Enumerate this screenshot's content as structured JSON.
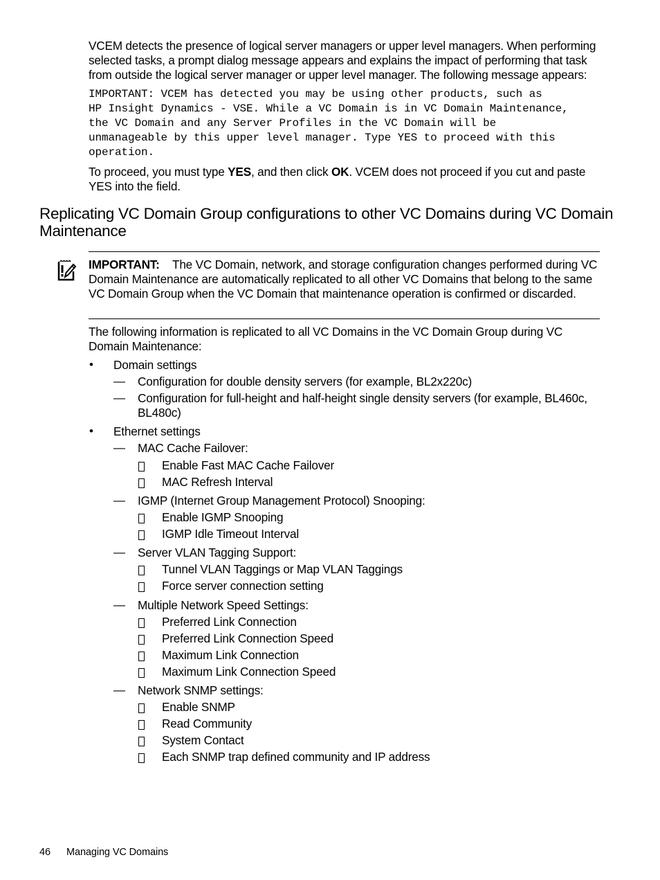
{
  "intro": {
    "para1": "VCEM detects the presence of logical server managers or upper level managers. When performing selected tasks, a prompt dialog message appears and explains the impact of performing that task from outside the logical server manager or upper level manager. The following message appears:",
    "message_lines": [
      "IMPORTANT: VCEM has detected you may be using other products, such as",
      "HP Insight Dynamics - VSE. While a VC Domain is in VC Domain Maintenance,",
      "the VC Domain and any Server Profiles in the VC Domain will be",
      "unmanageable by this upper level manager. Type YES to proceed with this",
      "operation."
    ],
    "para2_a": "To proceed, you must type ",
    "para2_yes": "YES",
    "para2_b": ", and then click ",
    "para2_ok": "OK",
    "para2_c": ". VCEM does not proceed if you cut and paste YES into the field."
  },
  "section": {
    "heading": "Replicating VC Domain Group configurations to other VC Domains during VC Domain Maintenance",
    "important_label": "IMPORTANT:",
    "important_text": "The VC Domain, network, and storage configuration changes performed during VC Domain Maintenance are automatically replicated to all other VC Domains that belong to the same VC Domain Group when the VC Domain that maintenance operation is confirmed or discarded.",
    "lead": "The following information is replicated to all VC Domains in the VC Domain Group during VC Domain Maintenance:",
    "bullet_glyph": "•",
    "dash_glyph": "—",
    "list": {
      "domain_settings": "Domain settings",
      "ds_1": "Configuration for double density servers (for example, BL2x220c)",
      "ds_2": "Configuration for full-height and half-height single density servers (for example, BL460c, BL480c)",
      "ethernet_settings": "Ethernet settings",
      "mac": "MAC Cache Failover:",
      "mac_1": "Enable Fast MAC Cache Failover",
      "mac_2": "MAC Refresh Interval",
      "igmp": "IGMP (Internet Group Management Protocol) Snooping:",
      "igmp_1": "Enable IGMP Snooping",
      "igmp_2": "IGMP Idle Timeout Interval",
      "vlan": "Server VLAN Tagging Support:",
      "vlan_1": "Tunnel VLAN Taggings or Map VLAN Taggings",
      "vlan_2": "Force server connection setting",
      "speed": "Multiple Network Speed Settings:",
      "speed_1": "Preferred Link Connection",
      "speed_2": "Preferred Link Connection Speed",
      "speed_3": "Maximum Link Connection",
      "speed_4": "Maximum Link Connection Speed",
      "snmp": "Network SNMP settings:",
      "snmp_1": "Enable SNMP",
      "snmp_2": "Read Community",
      "snmp_3": "System Contact",
      "snmp_4": "Each SNMP trap defined community and IP address"
    }
  },
  "footer": {
    "page_number": "46",
    "chapter": "Managing VC Domains"
  }
}
